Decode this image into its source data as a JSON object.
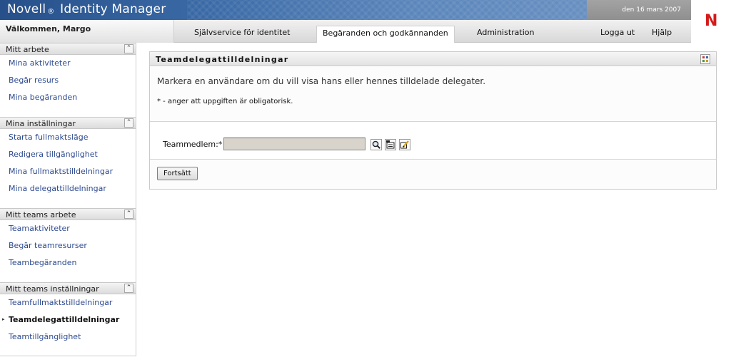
{
  "header": {
    "brand": "Novell",
    "brand_mark": "®",
    "brand_product": "Identity Manager",
    "date": "den 16 mars 2007",
    "logo_letter": "N",
    "welcome": "Välkommen, Margo"
  },
  "nav": {
    "tab_self_service": "Självservice för identitet",
    "tab_requests": "Begäranden och godkännanden",
    "tab_admin": "Administration",
    "logout": "Logga ut",
    "help": "Hjälp"
  },
  "sidebar": {
    "sections": [
      {
        "title": "Mitt arbete",
        "items": [
          "Mina aktiviteter",
          "Begär resurs",
          "Mina begäranden"
        ]
      },
      {
        "title": "Mina inställningar",
        "items": [
          "Starta fullmaktsläge",
          "Redigera tillgänglighet",
          "Mina fullmaktstilldelningar",
          "Mina delegattilldelningar"
        ]
      },
      {
        "title": "Mitt teams arbete",
        "items": [
          "Teamaktiviteter",
          "Begär teamresurser",
          "Teambegäranden"
        ]
      },
      {
        "title": "Mitt teams inställningar",
        "items": [
          "Teamfullmaktstilldelningar",
          "Teamdelegattilldelningar",
          "Teamtillgänglighet"
        ]
      }
    ],
    "collapse_glyph": "⌃",
    "current_bullet": "▸"
  },
  "panel": {
    "title": "Teamdelegattilldelningar",
    "instructions": "Markera en användare om du vill visa hans eller hennes tilldelade delegater.",
    "required_note": "* - anger att uppgiften är obligatorisk.",
    "member_label": "Teammedlem:*",
    "member_value": "",
    "continue_label": "Fortsätt"
  },
  "icons": {
    "search": "magnifier-icon",
    "history": "history-list-icon",
    "reset": "reset-edit-icon",
    "panel_menu": "grid-menu-icon"
  },
  "colors": {
    "brand_blue": "#27508a",
    "link_blue": "#2d4a8f",
    "logo_red": "#d51a1a"
  }
}
